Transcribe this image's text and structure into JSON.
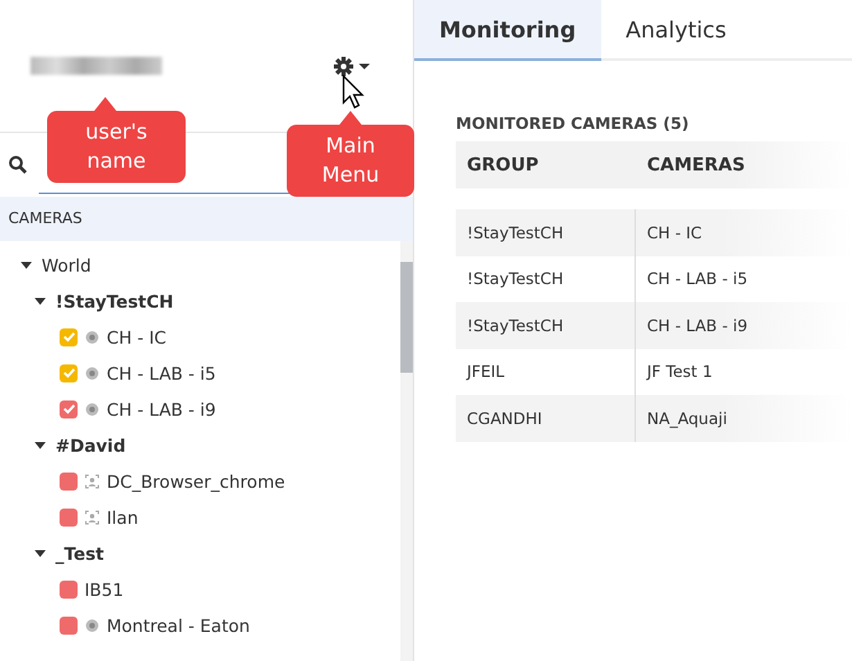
{
  "user": {
    "name_blurred": true
  },
  "tree_header": "CAMERAS",
  "tree": [
    {
      "label": "World",
      "expanded": true,
      "children": [
        {
          "label": "!StayTestCH",
          "expanded": true,
          "children": [
            {
              "label": "CH - IC",
              "kind": "dome",
              "checked": true,
              "color": "#f5b800"
            },
            {
              "label": "CH - LAB - i5",
              "kind": "dome",
              "checked": true,
              "color": "#f5b800"
            },
            {
              "label": "CH - LAB - i9",
              "kind": "dome",
              "checked": true,
              "color": "#ef6b6b"
            }
          ]
        },
        {
          "label": "#David",
          "expanded": true,
          "children": [
            {
              "label": "DC_Browser_chrome",
              "kind": "person",
              "checked": false,
              "color": "#ef6b6b"
            },
            {
              "label": "Ilan",
              "kind": "person",
              "checked": false,
              "color": "#ef6b6b"
            }
          ]
        },
        {
          "label": "_Test",
          "expanded": true,
          "children": [
            {
              "label": "IB51",
              "kind": "plain",
              "checked": false,
              "color": "#ef6b6b"
            },
            {
              "label": "Montreal - Eaton",
              "kind": "dome",
              "checked": false,
              "color": "#ef6b6b"
            }
          ]
        }
      ]
    }
  ],
  "tabs": [
    {
      "label": "Monitoring",
      "selected": true
    },
    {
      "label": "Analytics",
      "selected": false
    }
  ],
  "table": {
    "title": "MONITORED CAMERAS (5)",
    "columns": [
      "GROUP",
      "CAMERAS"
    ],
    "rows": [
      [
        "!StayTestCH",
        "CH - IC"
      ],
      [
        "!StayTestCH",
        "CH - LAB - i5"
      ],
      [
        "!StayTestCH",
        "CH - LAB - i9"
      ],
      [
        "JFEIL",
        "JF Test 1"
      ],
      [
        "CGANDHI",
        "NA_Aquaji"
      ]
    ]
  },
  "callouts": [
    {
      "text": "user's\nname"
    },
    {
      "text": "Main\nMenu"
    }
  ]
}
